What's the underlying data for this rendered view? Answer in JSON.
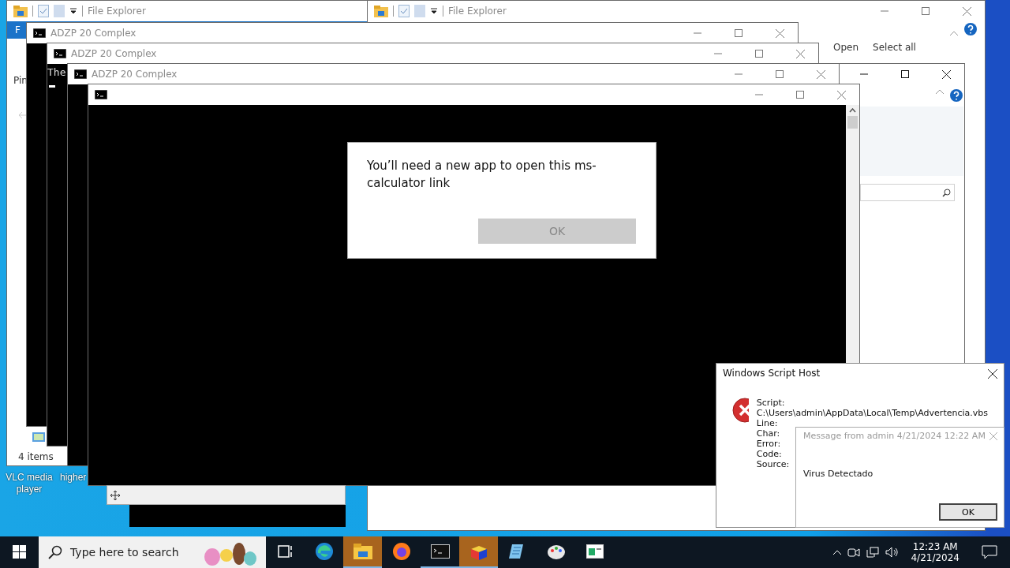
{
  "desktop": {
    "icons": [
      {
        "label": "VLC media player"
      },
      {
        "label": "higher"
      }
    ]
  },
  "explorer_windows": [
    {
      "title": "File Explorer",
      "ribbon_tab": "F",
      "nav_label": "Pin",
      "status": "4 items"
    },
    {
      "title": "File Explorer",
      "ribbon_items": [
        "Open",
        "Select all"
      ]
    },
    {
      "kind": "window"
    }
  ],
  "console_windows": [
    {
      "title": "ADZP 20 Complex"
    },
    {
      "title": "ADZP 20 Complex",
      "output": "The"
    },
    {
      "title": "ADZP 20 Complex"
    },
    {
      "kind": "window"
    }
  ],
  "app_dialog": {
    "message": "You’ll need a new app to open this ms-calculator link",
    "button": {
      "label": "OK",
      "disabled": true
    }
  },
  "script_host": {
    "title": "Windows Script Host",
    "fields": [
      {
        "label": "Script:",
        "value": "C:\\Users\\admin\\AppData\\Local\\Temp\\Advertencia.vbs"
      },
      {
        "label": "Line:"
      },
      {
        "label": "Char:"
      },
      {
        "label": "Error:"
      },
      {
        "label": "Code:"
      },
      {
        "label": "Source:"
      }
    ]
  },
  "message_box": {
    "title": "Message from admin 4/21/2024 12:22 AM",
    "body": "Virus Detectado",
    "button": "OK"
  },
  "taskbar": {
    "search_placeholder": "Type here to search",
    "apps": [
      {
        "kind": "task-view",
        "flashing": false,
        "running": false
      },
      {
        "kind": "edge",
        "flashing": false,
        "running": false
      },
      {
        "kind": "explorer",
        "flashing": true,
        "running": true
      },
      {
        "kind": "firefox",
        "flashing": false,
        "running": false
      },
      {
        "kind": "terminal",
        "flashing": false,
        "running": true
      },
      {
        "kind": "cube",
        "flashing": true,
        "running": true
      },
      {
        "kind": "notepad",
        "flashing": false,
        "running": false
      },
      {
        "kind": "paint",
        "flashing": false,
        "running": false
      },
      {
        "kind": "window",
        "flashing": false,
        "running": false
      }
    ],
    "time": "12:23 AM",
    "date": "4/21/2024"
  }
}
